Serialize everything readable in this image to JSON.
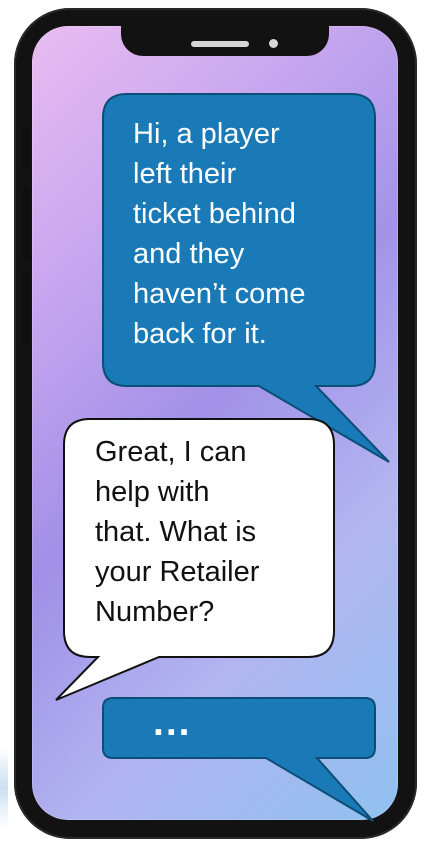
{
  "colors": {
    "phone_body": "#121212",
    "screen_top": "#e8b7f0",
    "screen_middle": "#9e8de7",
    "screen_bottom": "#8fc1ef",
    "agent_bubble": "#1a7ab8",
    "agent_bubble_border": "#0c4e75",
    "reply_bubble": "#ffffff",
    "reply_bubble_border": "#111111"
  },
  "conversation": {
    "agent_message": "Hi, a player\nleft their\nticket behind\nand they\nhaven’t come\nback for it.",
    "reply_message": "Great, I can\nhelp with\nthat. What is\nyour Retailer\nNumber?",
    "typing_indicator": "..."
  },
  "icons": {
    "notch": "notch-icon",
    "speaker": "speaker-icon",
    "camera": "camera-icon"
  }
}
